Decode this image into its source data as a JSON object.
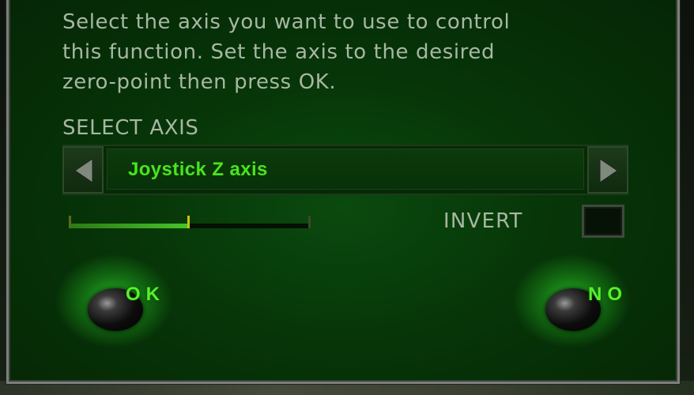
{
  "dialog": {
    "instructions": "Select the axis you want to use to control\nthis function. Set the axis to the desired\nzero-point then press OK.",
    "select_axis_label": "SELECT AXIS",
    "axis_value": "Joystick Z axis",
    "meter": {
      "fill_fraction": 0.5
    },
    "invert": {
      "label": "INVERT",
      "checked": false
    },
    "buttons": {
      "ok_label": "OK",
      "no_label": "NO"
    }
  },
  "icons": {
    "previous": "triangle-left-icon",
    "next": "triangle-right-icon"
  },
  "colors": {
    "accent_green": "#49e41e",
    "panel_dark_green": "#052605",
    "text_grey": "#a7b7a2"
  }
}
